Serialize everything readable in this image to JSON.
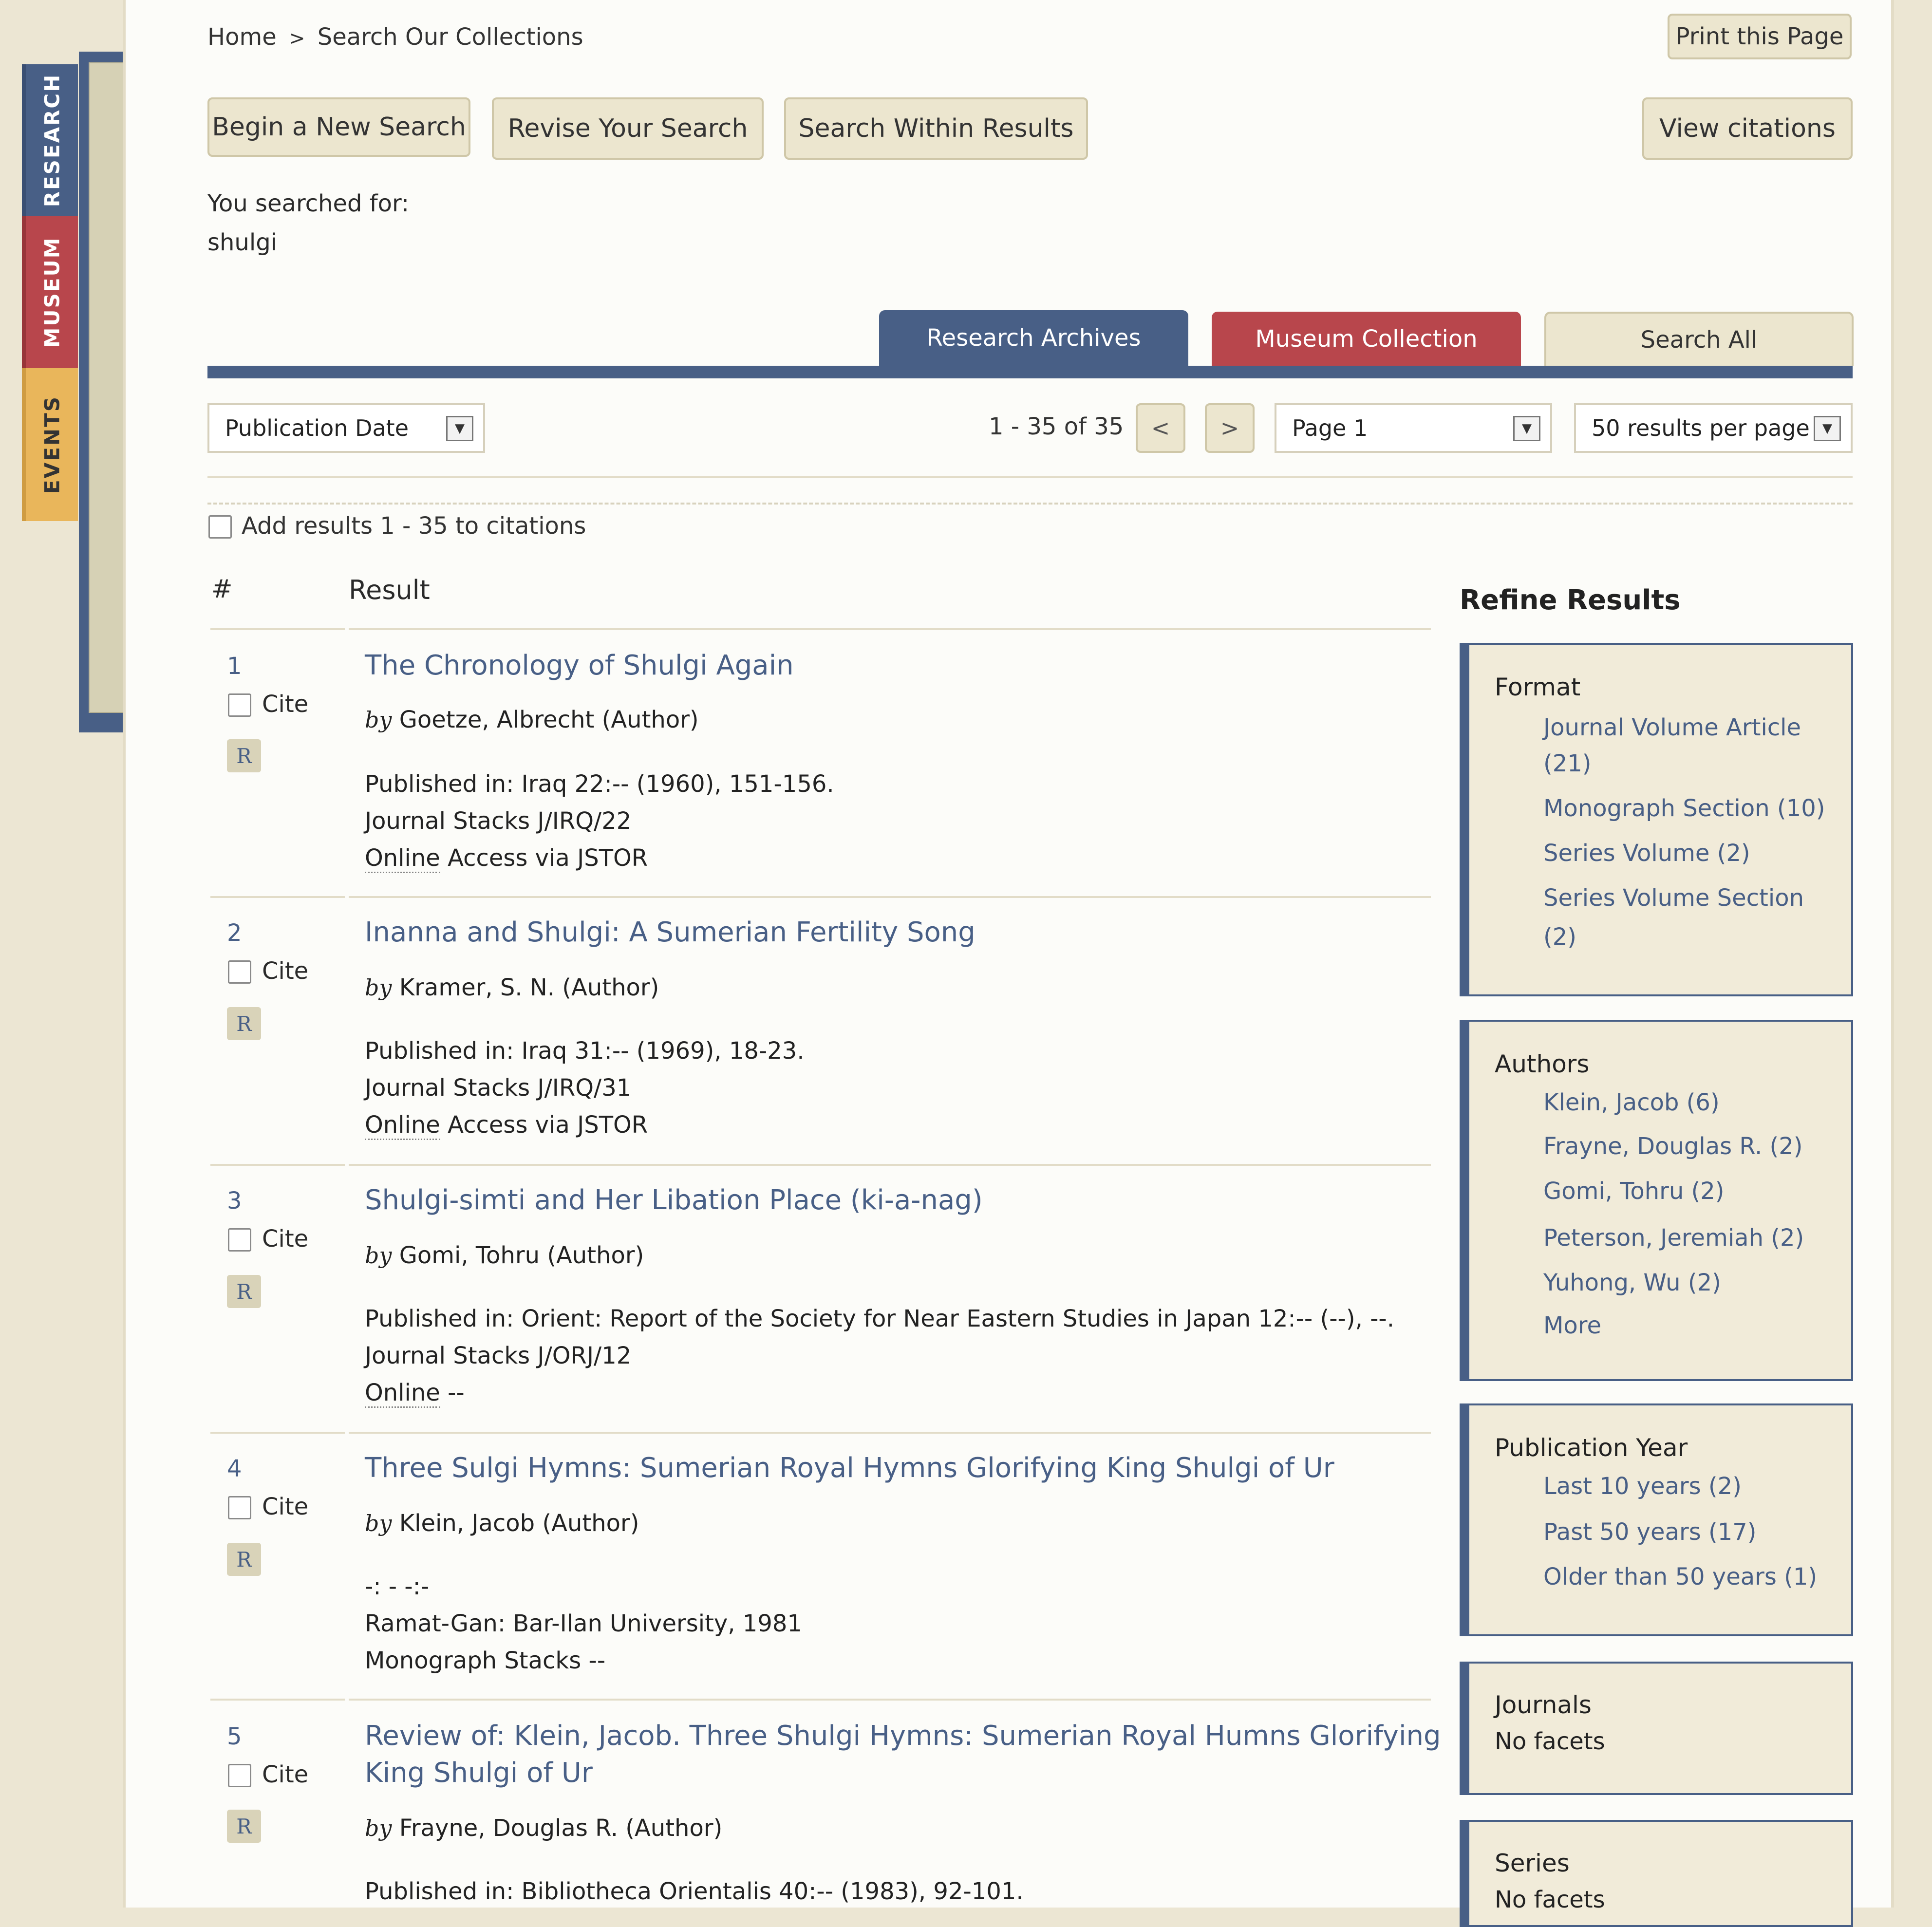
{
  "side_tabs": [
    "RESEARCH",
    "MUSEUM",
    "EVENTS"
  ],
  "breadcrumb": {
    "home": "Home",
    "sep": ">",
    "current": "Search Our Collections"
  },
  "print_label": "Print this Page",
  "actions": {
    "new_search": "Begin a New Search",
    "revise": "Revise Your Search",
    "within": "Search Within Results",
    "view_citations": "View citations"
  },
  "searched_for": {
    "label": "You searched for:",
    "query": "shulgi"
  },
  "tabs": [
    "Research Archives",
    "Museum Collection",
    "Search All"
  ],
  "colors": {
    "research": "#485f86",
    "museum": "#b8464c",
    "events": "#e9b65b",
    "link": "#485f86"
  },
  "toolbar": {
    "sort_value": "Publication Date",
    "range": "1 - 35 of 35",
    "prev": "<",
    "next": ">",
    "page_value": "Page 1",
    "per_page_value": "50 results per page"
  },
  "add_citations": "Add results 1 - 35 to citations",
  "table_headers": {
    "num": "#",
    "result": "Result"
  },
  "cite_label": "Cite",
  "r_badge": "R",
  "by_label": "by",
  "results": [
    {
      "num": "1",
      "title": "The Chronology of Shulgi Again",
      "author": "Goetze, Albrecht (Author)",
      "line1": "Published in: Iraq 22:-- (1960), 151-156.",
      "line2": "Journal Stacks J/IRQ/22",
      "online_word": "Online",
      "online_rest": " Access via JSTOR"
    },
    {
      "num": "2",
      "title": "Inanna and Shulgi: A Sumerian Fertility Song",
      "author": "Kramer, S. N. (Author)",
      "line1": "Published in: Iraq 31:-- (1969), 18-23.",
      "line2": "Journal Stacks J/IRQ/31",
      "online_word": "Online",
      "online_rest": " Access via JSTOR"
    },
    {
      "num": "3",
      "title": "Shulgi-simti and Her Libation Place (ki-a-nag)",
      "author": "Gomi, Tohru (Author)",
      "line1": "Published in: Orient: Report of the Society for Near Eastern Studies in Japan 12:-- (--), --.",
      "line2": "Journal Stacks J/ORJ/12",
      "online_word": "Online",
      "online_rest": " --"
    },
    {
      "num": "4",
      "title": "Three Sulgi Hymns: Sumerian Royal Hymns Glorifying King Shulgi of Ur",
      "author": "Klein, Jacob (Author)",
      "line1": "-: - -:-",
      "line2": "Ramat-Gan: Bar-Ilan University, 1981",
      "line3": "Monograph Stacks --"
    },
    {
      "num": "5",
      "title_line1": "Review of: Klein, Jacob. Three Shulgi Hymns: Sumerian Royal Humns Glorifying",
      "title_line2": "King Shulgi of Ur",
      "author": "Frayne, Douglas R. (Author)",
      "line1": "Published in: Bibliotheca Orientalis 40:-- (1983), 92-101."
    }
  ],
  "refine": {
    "heading": "Refine Results",
    "format": {
      "title": "Format",
      "items": [
        "Journal Volume Article",
        "(21)",
        "Monograph Section (10)",
        "Series Volume (2)",
        "Series Volume Section",
        "(2)"
      ]
    },
    "authors": {
      "title": "Authors",
      "items": [
        "Klein, Jacob (6)",
        "Frayne, Douglas R. (2)",
        "Gomi, Tohru (2)",
        "Peterson, Jeremiah (2)",
        "Yuhong, Wu (2)",
        "More"
      ]
    },
    "year": {
      "title": "Publication Year",
      "items": [
        "Last 10 years (2)",
        "Past 50 years (17)",
        "Older than 50 years (1)"
      ]
    },
    "journals": {
      "title": "Journals",
      "none": "No facets"
    },
    "series": {
      "title": "Series",
      "none": "No facets"
    }
  }
}
